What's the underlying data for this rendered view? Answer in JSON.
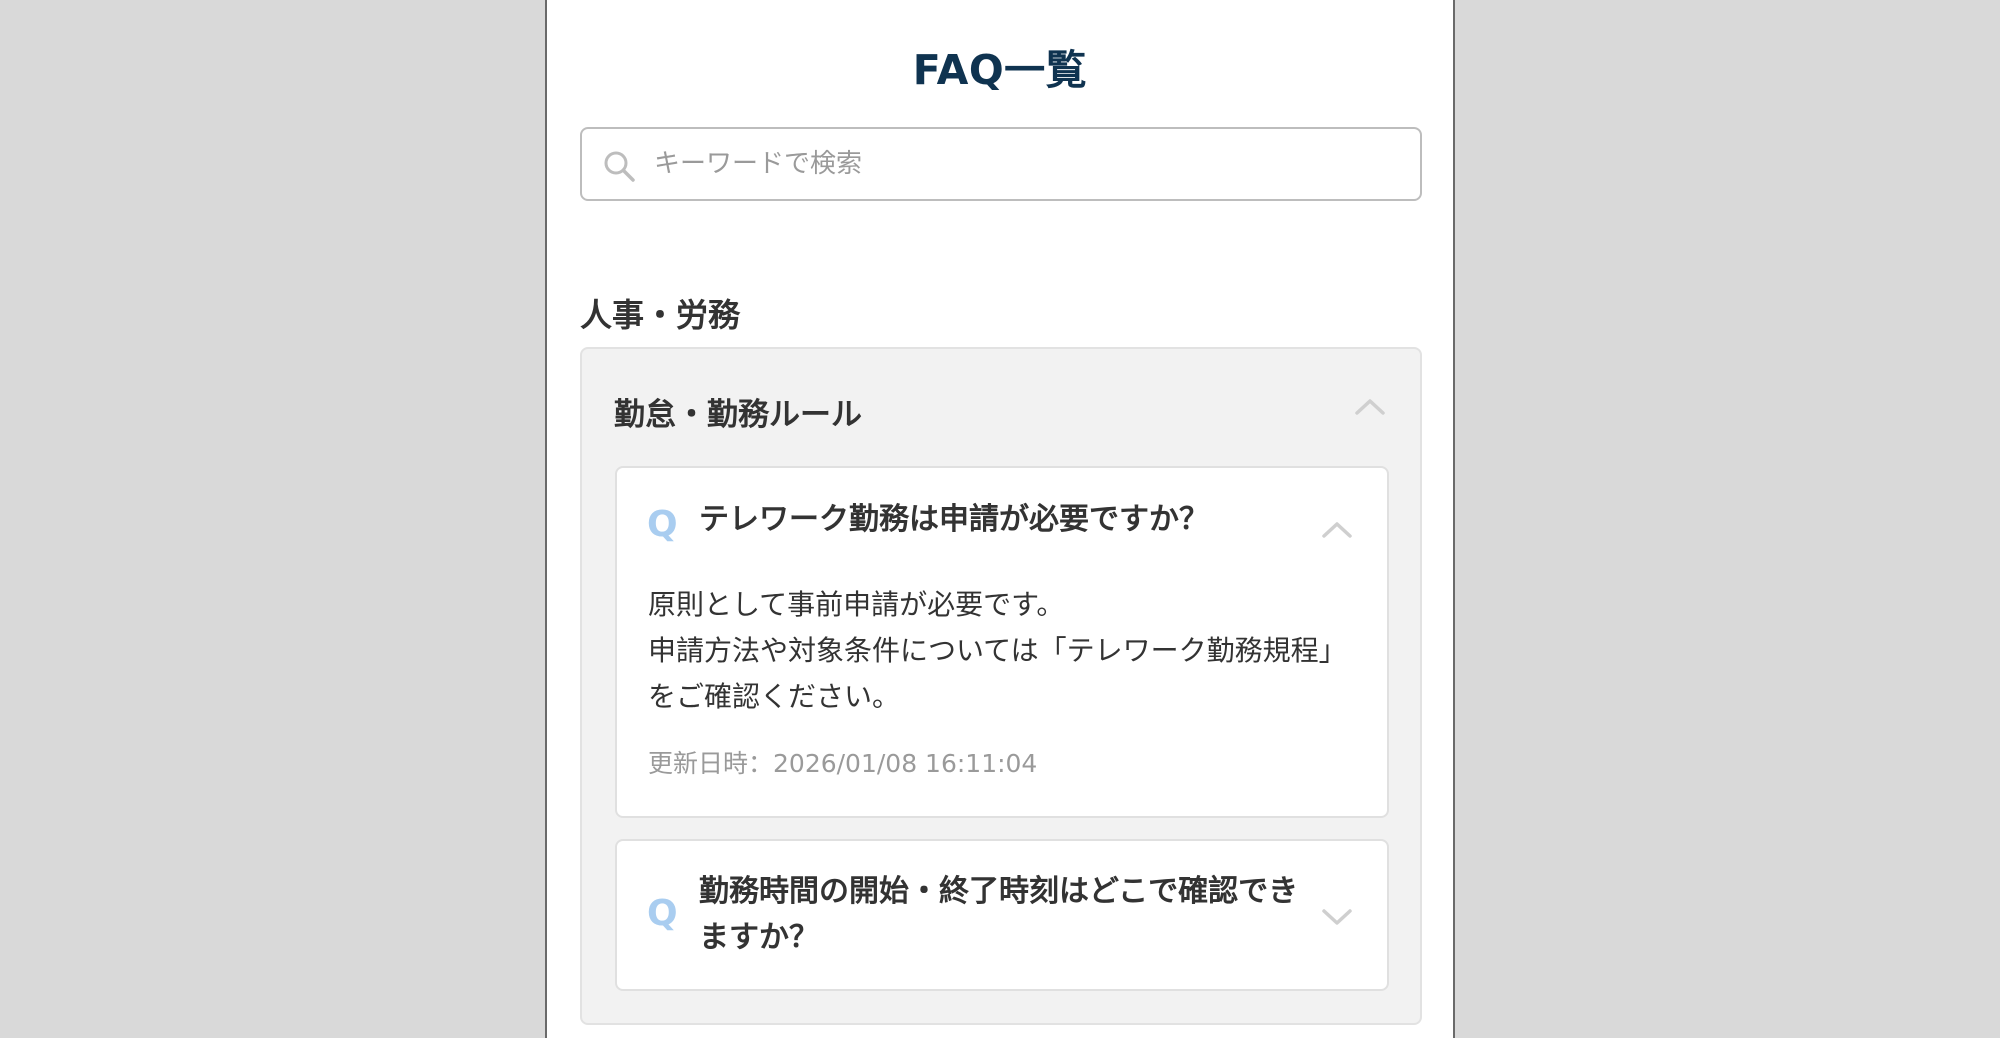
{
  "page": {
    "title": "FAQ一覧"
  },
  "search": {
    "placeholder": "キーワードで検索",
    "value": "",
    "icon": "search-icon"
  },
  "section": {
    "title": "人事・労務",
    "category": {
      "title": "勤怠・勤務ルール",
      "expanded": true,
      "faqs": [
        {
          "q_mark": "Q",
          "question": "テレワーク勤務は申請が必要ですか？",
          "expanded": true,
          "answer_lines": [
            "原則として事前申請が必要です。",
            "申請方法や対象条件については「テレワーク勤務規程」をご確認ください。"
          ],
          "updated_label": "更新日時：",
          "updated_value": "2026/01/08 16:11:04"
        },
        {
          "q_mark": "Q",
          "question": "勤務時間の開始・終了時刻はどこで確認できますか？",
          "expanded": false
        }
      ]
    }
  },
  "colors": {
    "title": "#0f3350",
    "q_mark": "#a9cdf0",
    "text": "#333333",
    "muted": "#9a9a9a",
    "category_bg": "#f2f2f2",
    "page_bg": "#d9d9d9"
  }
}
